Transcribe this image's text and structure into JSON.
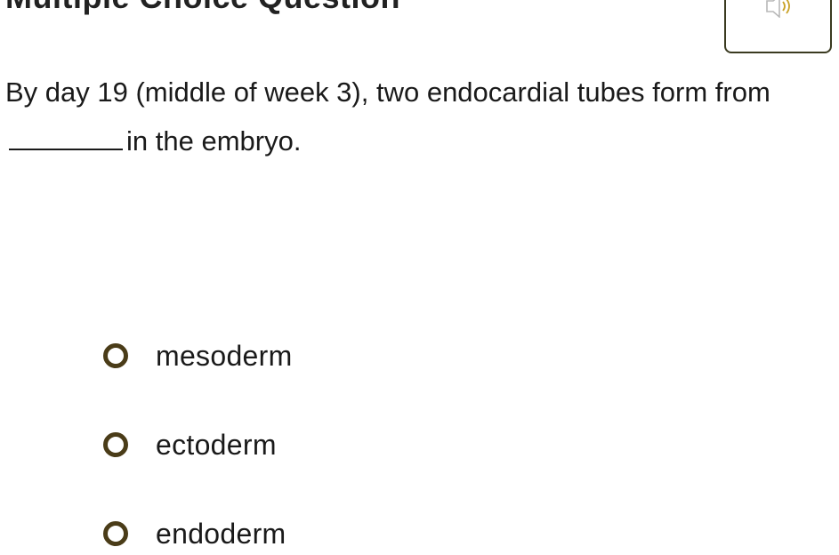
{
  "header": {
    "title": "Multiple Choice Question",
    "audio_icon": "speaker-icon"
  },
  "question": {
    "text_before": "By day 19 (middle of week 3), two endocardial tubes form from",
    "text_after": "in the embryo."
  },
  "options": [
    {
      "label": "mesoderm",
      "selected": false
    },
    {
      "label": "ectoderm",
      "selected": false
    },
    {
      "label": "endoderm",
      "selected": false
    }
  ],
  "colors": {
    "radio_border": "#4a3c18",
    "audio_icon": "#c9a227",
    "text": "#1a1a1a"
  }
}
